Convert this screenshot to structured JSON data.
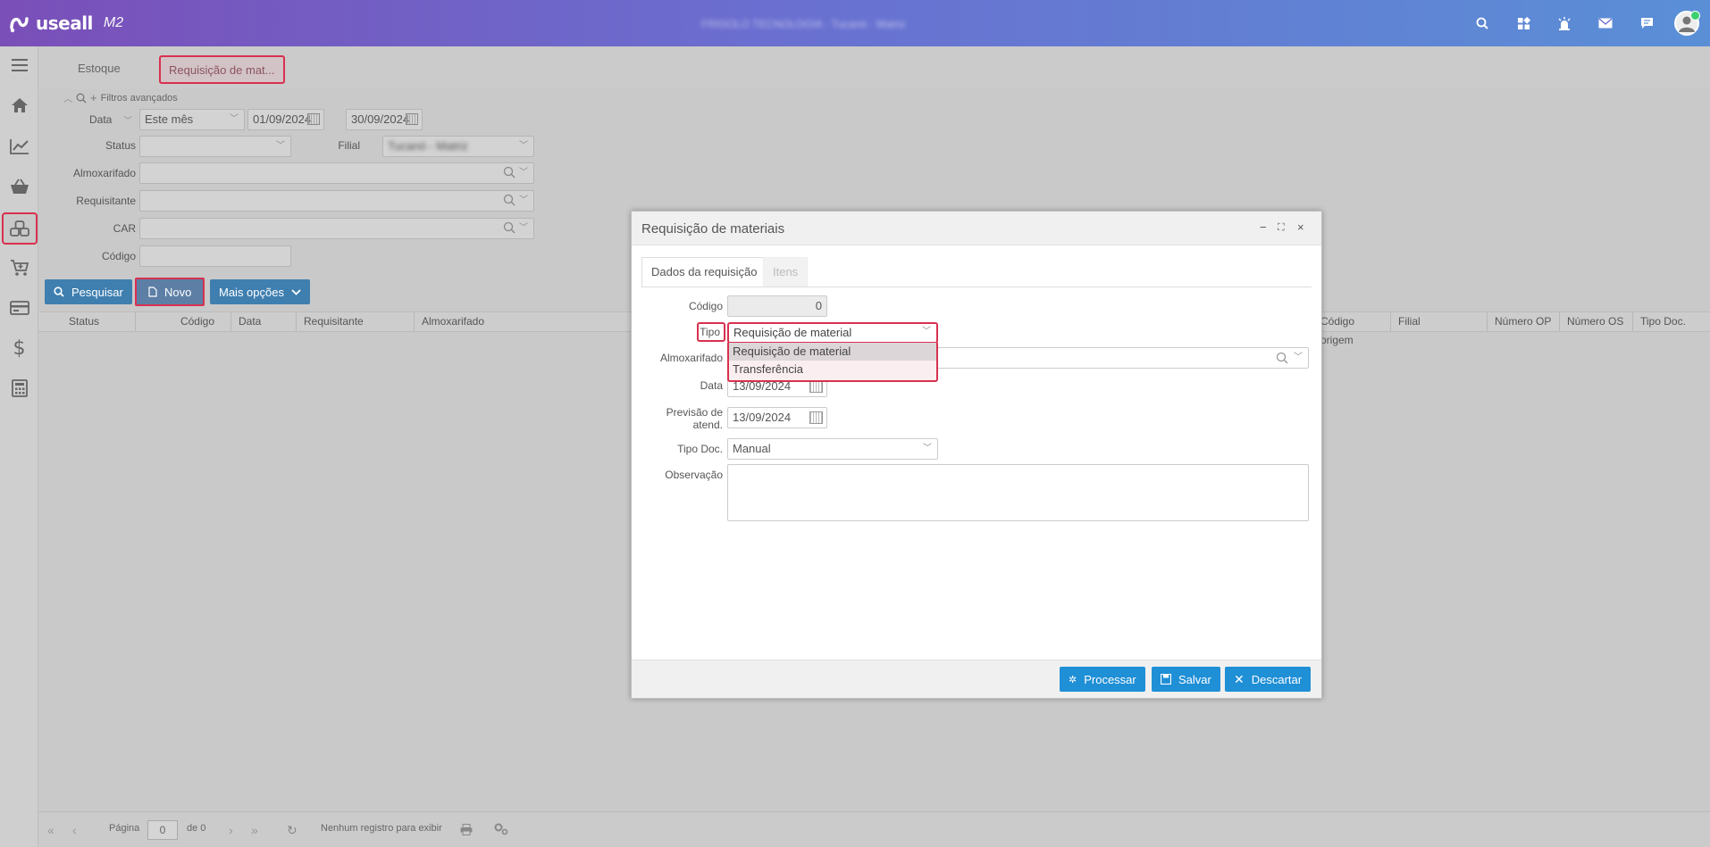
{
  "app": {
    "logo_text": "useall",
    "logo_suffix": "M2",
    "top_center_text": "FRIGOLO TECNOLOGIA · Tucanò · Matriz"
  },
  "tabs": [
    {
      "label": "Estoque"
    },
    {
      "label": "Requisição de mat..."
    }
  ],
  "filters": {
    "advanced_label": "Filtros avançados",
    "data_label": "Data",
    "period_value": "Este mês",
    "date_from": "01/09/2024",
    "date_to": "30/09/2024",
    "status_label": "Status",
    "filial_label": "Filial",
    "filial_value": "Tucanò - Matriz",
    "almox_label": "Almoxarifado",
    "requisitante_label": "Requisitante",
    "car_label": "CAR",
    "codigo_label": "Código"
  },
  "actions": {
    "pesquisar": "Pesquisar",
    "novo": "Novo",
    "mais_opcoes": "Mais opções"
  },
  "grid": {
    "columns": [
      "Status",
      "Código",
      "Data",
      "Requisitante",
      "Almoxarifado",
      "Código origem",
      "Filial",
      "Número OP",
      "Número OS",
      "Tipo Doc."
    ]
  },
  "pager": {
    "page_label": "Página",
    "page_value": "0",
    "of_label": "de 0",
    "empty_msg": "Nenhum registro para exibir"
  },
  "dialog": {
    "title": "Requisição de materiais",
    "tabs": [
      "Dados da requisição",
      "Itens"
    ],
    "codigo_label": "Código",
    "codigo_value": "0",
    "tipo_label": "Tipo",
    "tipo_value": "Requisição de material",
    "tipo_options": [
      "Requisição de material",
      "Transferência"
    ],
    "almox_label": "Almoxarifado",
    "data_label": "Data",
    "data_value": "13/09/2024",
    "previsao_label_1": "Previsão de",
    "previsao_label_2": "atend.",
    "previsao_value": "13/09/2024",
    "tipo_doc_label": "Tipo Doc.",
    "tipo_doc_value": "Manual",
    "obs_label": "Observação",
    "buttons": {
      "processar": "Processar",
      "salvar": "Salvar",
      "descartar": "Descartar"
    }
  },
  "colors": {
    "accent": "#1f8fd6",
    "highlight": "#d9304f",
    "topbar_start": "#7a4fb8",
    "topbar_end": "#5a8fd6"
  }
}
